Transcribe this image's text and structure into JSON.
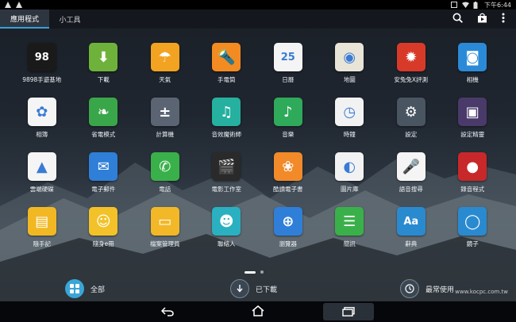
{
  "status": {
    "time": "下午6:44"
  },
  "tabs": [
    {
      "label": "應用程式",
      "active": true
    },
    {
      "label": "小工具",
      "active": false
    }
  ],
  "apps": [
    {
      "label": "9898手遊基地",
      "bg": "#1a1a1a",
      "glyph": "98"
    },
    {
      "label": "下載",
      "bg": "#6fb23b",
      "glyph": "⬇"
    },
    {
      "label": "天氣",
      "bg": "#f2a321",
      "glyph": "☂"
    },
    {
      "label": "手電筒",
      "bg": "#f28b22",
      "glyph": "🔦"
    },
    {
      "label": "日曆",
      "bg": "#f4f4f4",
      "glyph": "25"
    },
    {
      "label": "地圖",
      "bg": "#e9e4d8",
      "glyph": "◉"
    },
    {
      "label": "安兔兔X評測",
      "bg": "#d83a2a",
      "glyph": "✹"
    },
    {
      "label": "相機",
      "bg": "#2b8ad8",
      "glyph": "◙"
    },
    {
      "label": "相簿",
      "bg": "#f5f5f5",
      "glyph": "✿"
    },
    {
      "label": "省電模式",
      "bg": "#3aa64a",
      "glyph": "❧"
    },
    {
      "label": "計算機",
      "bg": "#5a6472",
      "glyph": "±"
    },
    {
      "label": "音效魔術師",
      "bg": "#26b0a0",
      "glyph": "♫"
    },
    {
      "label": "音樂",
      "bg": "#2eaa5a",
      "glyph": "♪"
    },
    {
      "label": "時鐘",
      "bg": "#f2f2f2",
      "glyph": "◷"
    },
    {
      "label": "設定",
      "bg": "#4a5562",
      "glyph": "⚙"
    },
    {
      "label": "設定精靈",
      "bg": "#4a3a6a",
      "glyph": "▣"
    },
    {
      "label": "雲端硬碟",
      "bg": "#f5f5f5",
      "glyph": "▲"
    },
    {
      "label": "電子郵件",
      "bg": "#2f7fd8",
      "glyph": "✉"
    },
    {
      "label": "電話",
      "bg": "#3ab04a",
      "glyph": "✆"
    },
    {
      "label": "電影工作室",
      "bg": "#2a2a2a",
      "glyph": "🎬"
    },
    {
      "label": "酷讀電子書",
      "bg": "#f28a2a",
      "glyph": "❀"
    },
    {
      "label": "圖片庫",
      "bg": "#f2f2f2",
      "glyph": "◐"
    },
    {
      "label": "語音搜尋",
      "bg": "#f5f5f5",
      "glyph": "🎤"
    },
    {
      "label": "錄音程式",
      "bg": "#c8282a",
      "glyph": "●"
    },
    {
      "label": "隨手記",
      "bg": "#f2b824",
      "glyph": "▤"
    },
    {
      "label": "隨身e冊",
      "bg": "#f2c228",
      "glyph": "☺"
    },
    {
      "label": "檔案管理員",
      "bg": "#f2b828",
      "glyph": "▭"
    },
    {
      "label": "聯絡人",
      "bg": "#2ab0c0",
      "glyph": "☻"
    },
    {
      "label": "瀏覽器",
      "bg": "#2f7fd8",
      "glyph": "⊕"
    },
    {
      "label": "簡訊",
      "bg": "#3ab04a",
      "glyph": "☰"
    },
    {
      "label": "辭典",
      "bg": "#2a8ad0",
      "glyph": "Aa"
    },
    {
      "label": "鏡子",
      "bg": "#2a8ad0",
      "glyph": "◯"
    }
  ],
  "bottom": {
    "all_label": "全部",
    "downloaded_label": "已下載",
    "frequent_label": "最常使用"
  },
  "watermark": "www.kocpc.com.tw"
}
